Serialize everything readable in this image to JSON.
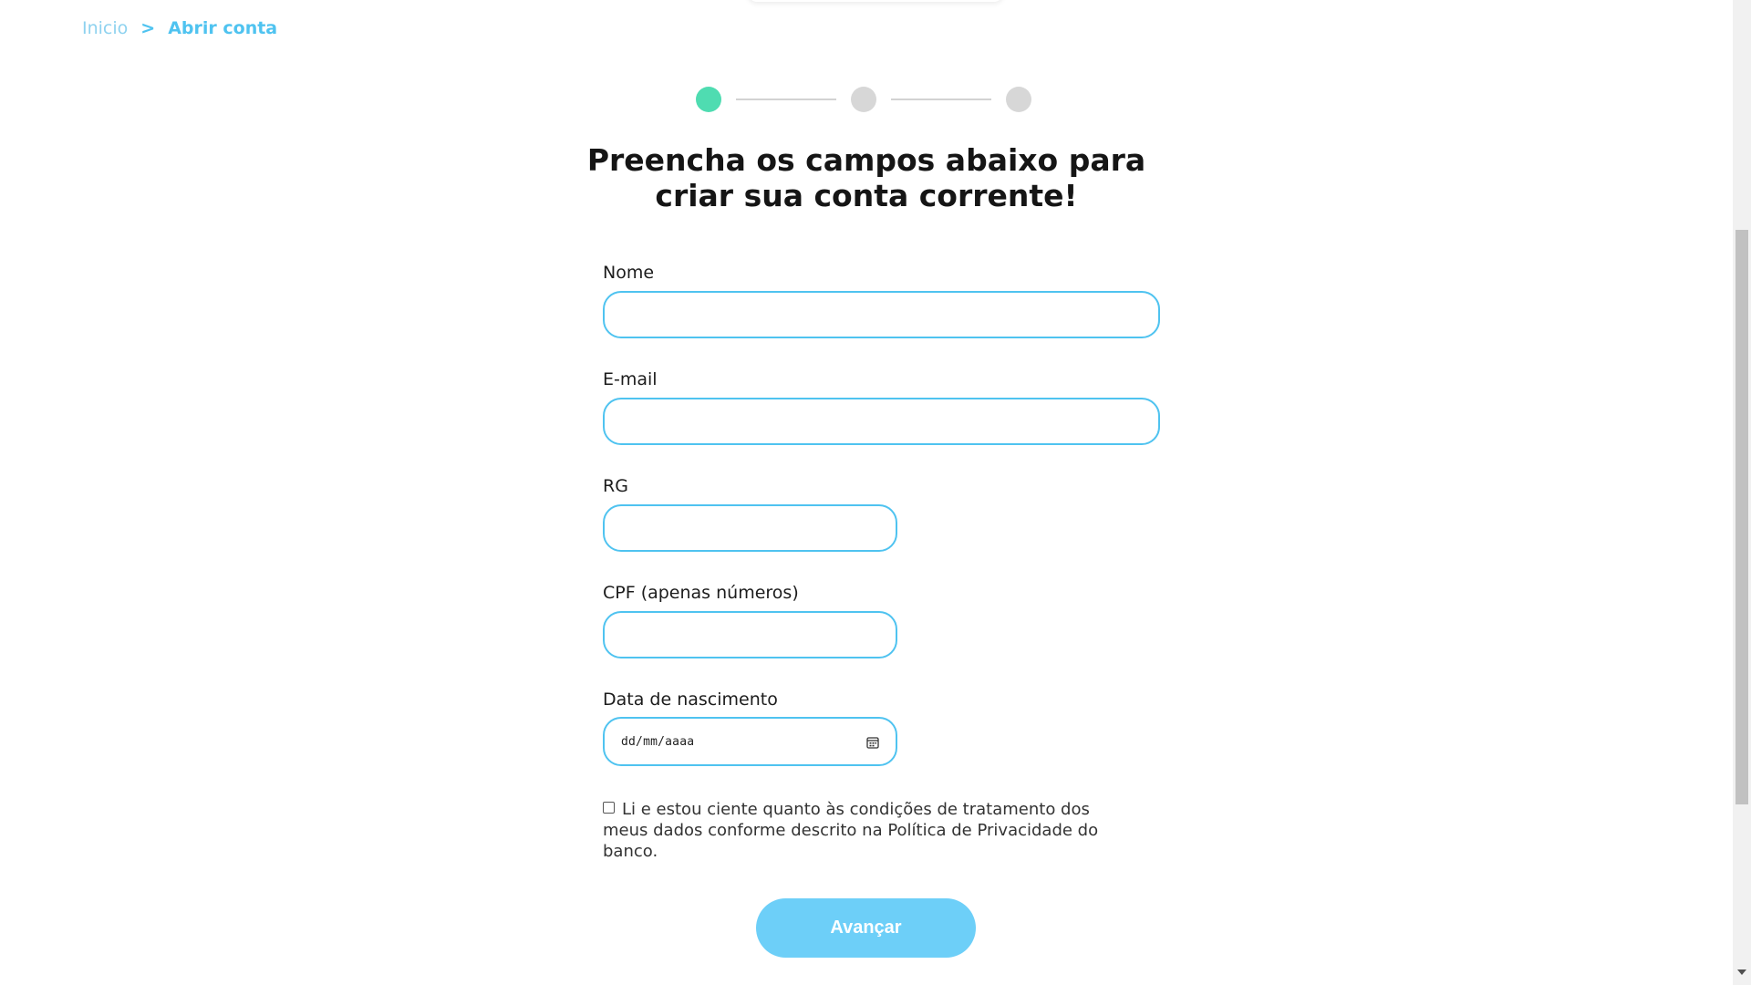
{
  "breadcrumb": {
    "home": "Inicio",
    "separator": ">",
    "current": "Abrir conta"
  },
  "stepper": {
    "current_step": 1,
    "total_steps": 3,
    "active_color": "#4fdcb1",
    "inactive_color": "#d7d7d7"
  },
  "heading": {
    "line1": "Preencha os campos abaixo para",
    "line2": "criar sua conta corrente!"
  },
  "form": {
    "nome_label": "Nome",
    "nome_value": "",
    "email_label": "E-mail",
    "email_value": "",
    "rg_label": "RG",
    "rg_value": "",
    "cpf_label": "CPF (apenas números)",
    "cpf_value": "",
    "birth_label": "Data de nascimento",
    "birth_placeholder": "dd/mm/aaaa",
    "consent_text": "Li e estou ciente quanto às condições de tratamento dos meus dados conforme descrito na Política de Privacidade do banco.",
    "consent_checked": false,
    "submit_label": "Avançar"
  },
  "colors": {
    "accent": "#4fc3f0",
    "button": "#6dcff8",
    "breadcrumb_home": "#8ed2ef"
  },
  "icons": {
    "date_picker": "calendar-icon",
    "consent_box": "checkbox-icon"
  }
}
